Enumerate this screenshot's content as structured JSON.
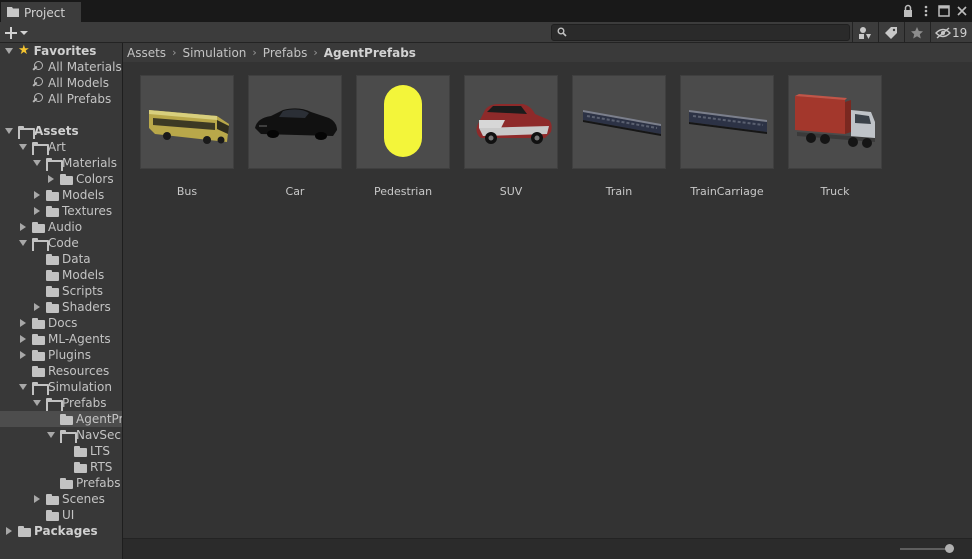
{
  "window": {
    "tab_label": "Project"
  },
  "toolbar": {
    "search_placeholder": "",
    "hidden_packages_count": "19"
  },
  "tree": [
    {
      "label": "Favorites",
      "level": 0,
      "kind": "star",
      "arrow": "down",
      "bold": true
    },
    {
      "label": "All Materials",
      "level": 1,
      "kind": "search",
      "arrow": "none"
    },
    {
      "label": "All Models",
      "level": 1,
      "kind": "search",
      "arrow": "none"
    },
    {
      "label": "All Prefabs",
      "level": 1,
      "kind": "search",
      "arrow": "none"
    },
    {
      "label": "",
      "level": 0,
      "kind": "spacer",
      "arrow": "none"
    },
    {
      "label": "Assets",
      "level": 0,
      "kind": "folder-open",
      "arrow": "down",
      "bold": true
    },
    {
      "label": "Art",
      "level": 1,
      "kind": "folder-open",
      "arrow": "down"
    },
    {
      "label": "Materials",
      "level": 2,
      "kind": "folder-open",
      "arrow": "down"
    },
    {
      "label": "Colors",
      "level": 3,
      "kind": "folder",
      "arrow": "right"
    },
    {
      "label": "Models",
      "level": 2,
      "kind": "folder",
      "arrow": "right"
    },
    {
      "label": "Textures",
      "level": 2,
      "kind": "folder",
      "arrow": "right"
    },
    {
      "label": "Audio",
      "level": 1,
      "kind": "folder",
      "arrow": "right"
    },
    {
      "label": "Code",
      "level": 1,
      "kind": "folder-open",
      "arrow": "down"
    },
    {
      "label": "Data",
      "level": 2,
      "kind": "folder",
      "arrow": "none"
    },
    {
      "label": "Models",
      "level": 2,
      "kind": "folder",
      "arrow": "none"
    },
    {
      "label": "Scripts",
      "level": 2,
      "kind": "folder",
      "arrow": "none"
    },
    {
      "label": "Shaders",
      "level": 2,
      "kind": "folder",
      "arrow": "right"
    },
    {
      "label": "Docs",
      "level": 1,
      "kind": "folder",
      "arrow": "right"
    },
    {
      "label": "ML-Agents",
      "level": 1,
      "kind": "folder",
      "arrow": "right"
    },
    {
      "label": "Plugins",
      "level": 1,
      "kind": "folder",
      "arrow": "right"
    },
    {
      "label": "Resources",
      "level": 1,
      "kind": "folder",
      "arrow": "none"
    },
    {
      "label": "Simulation",
      "level": 1,
      "kind": "folder-open",
      "arrow": "down"
    },
    {
      "label": "Prefabs",
      "level": 2,
      "kind": "folder-open",
      "arrow": "down"
    },
    {
      "label": "AgentPr",
      "level": 3,
      "kind": "folder",
      "arrow": "none",
      "selected": true
    },
    {
      "label": "NavSec",
      "level": 3,
      "kind": "folder-open",
      "arrow": "down"
    },
    {
      "label": "LTS",
      "level": 4,
      "kind": "folder",
      "arrow": "none"
    },
    {
      "label": "RTS",
      "level": 4,
      "kind": "folder",
      "arrow": "none"
    },
    {
      "label": "Prefabs",
      "level": 3,
      "kind": "folder",
      "arrow": "none"
    },
    {
      "label": "Scenes",
      "level": 2,
      "kind": "folder",
      "arrow": "right"
    },
    {
      "label": "UI",
      "level": 2,
      "kind": "folder",
      "arrow": "none"
    },
    {
      "label": "Packages",
      "level": 0,
      "kind": "folder",
      "arrow": "right",
      "bold": true
    }
  ],
  "breadcrumb": [
    "Assets",
    "Simulation",
    "Prefabs",
    "AgentPrefabs"
  ],
  "assets": [
    {
      "label": "Bus",
      "icon": "bus-model"
    },
    {
      "label": "Car",
      "icon": "car-model"
    },
    {
      "label": "Pedestrian",
      "icon": "capsule-model"
    },
    {
      "label": "SUV",
      "icon": "suv-model"
    },
    {
      "label": "Train",
      "icon": "train-model"
    },
    {
      "label": "TrainCarriage",
      "icon": "train-carriage-model"
    },
    {
      "label": "Truck",
      "icon": "truck-model"
    }
  ],
  "colors": {
    "accent_star": "#f4c430",
    "pedestrian_capsule": "#f3f53a"
  }
}
